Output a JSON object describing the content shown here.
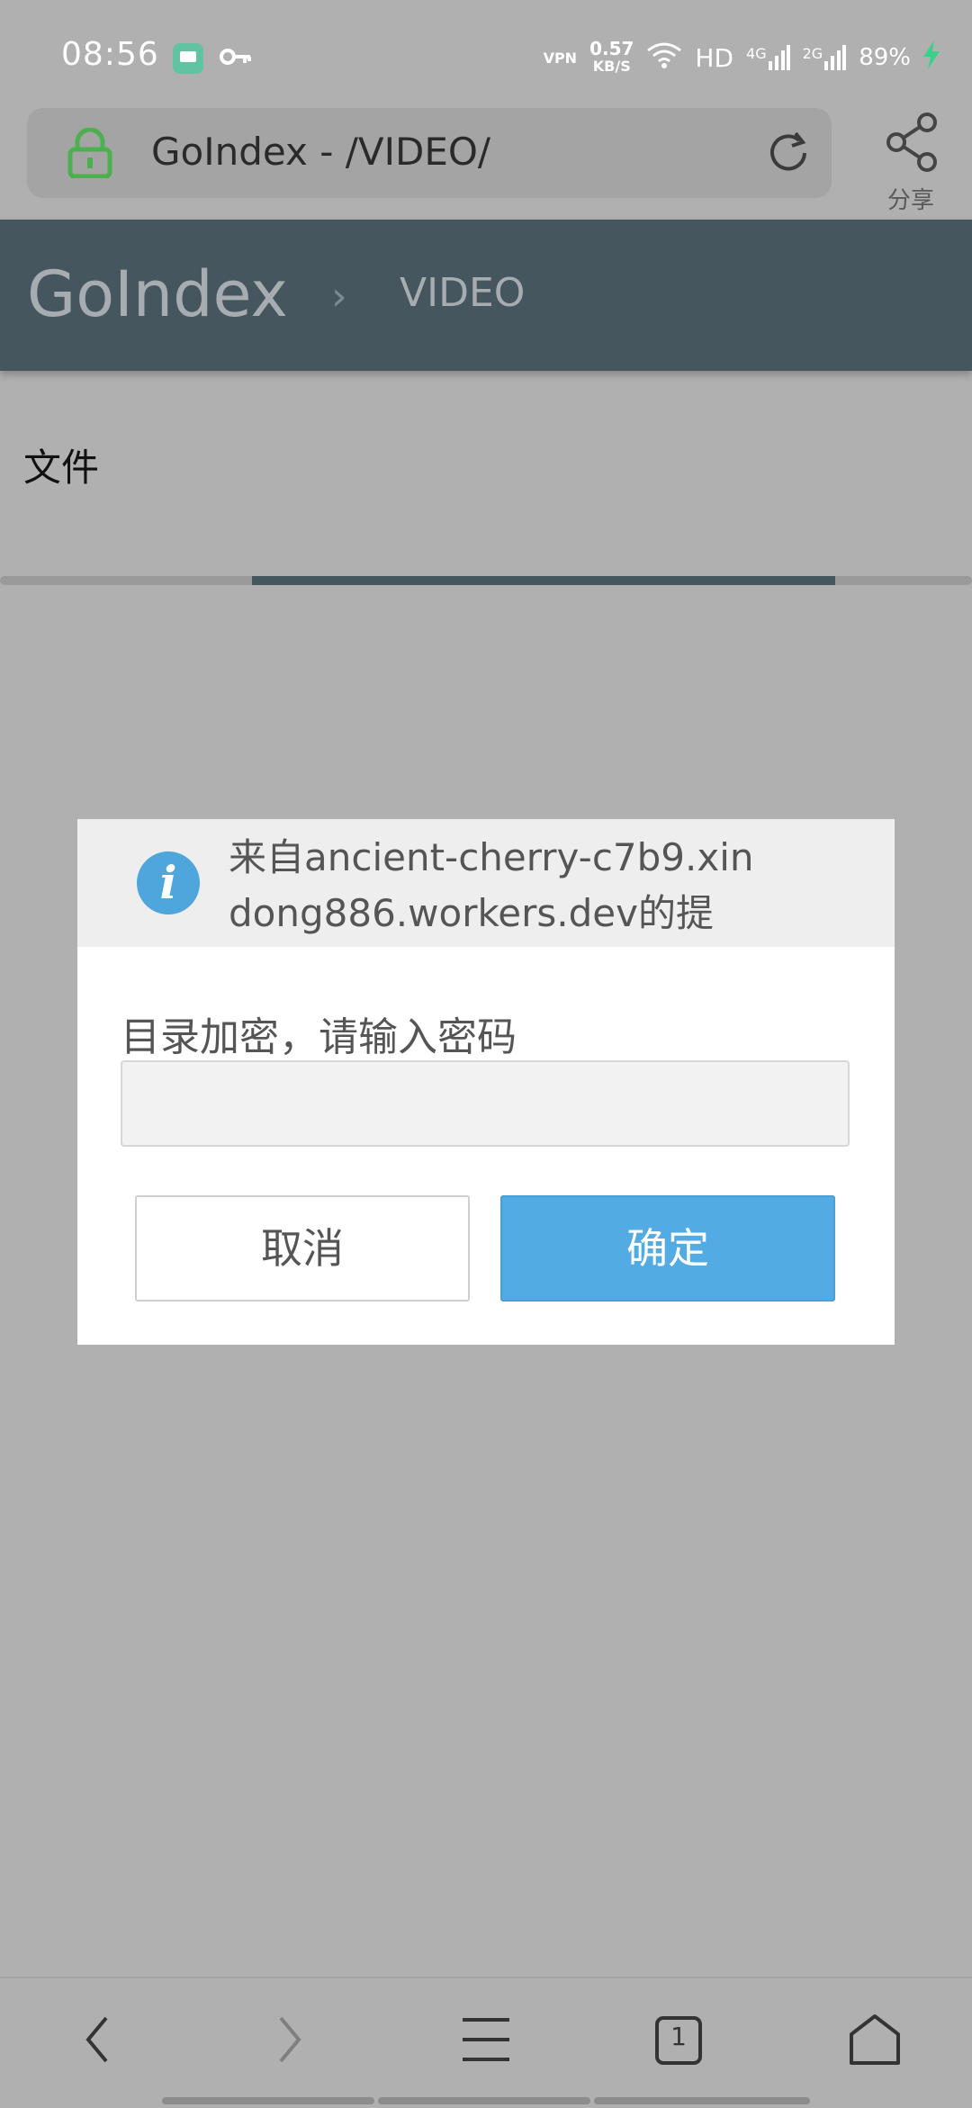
{
  "status_bar": {
    "time": "08:56",
    "vpn": "VPN",
    "speed_value": "0.57",
    "speed_unit": "KB/S",
    "hd": "HD",
    "net1": "4G",
    "net2": "2G",
    "battery": "89%"
  },
  "browser": {
    "url_title": "GoIndex - /VIDEO/",
    "share_label": "分享"
  },
  "header": {
    "brand": "GoIndex",
    "chevron": "›",
    "breadcrumb": "VIDEO"
  },
  "content": {
    "section_label": "文件",
    "progress": 0.6
  },
  "dialog": {
    "title": "来自ancient-cherry-c7b9.xindong886.workers.dev的提",
    "message": "目录加密，请输入密码",
    "input_value": "",
    "cancel_label": "取消",
    "ok_label": "确定"
  },
  "nav": {
    "tab_count": "1"
  },
  "colors": {
    "header_bg": "#45565f",
    "accent_button": "#52abe3",
    "lock_green": "#4caf50",
    "overlay": "#b0b0b0"
  }
}
